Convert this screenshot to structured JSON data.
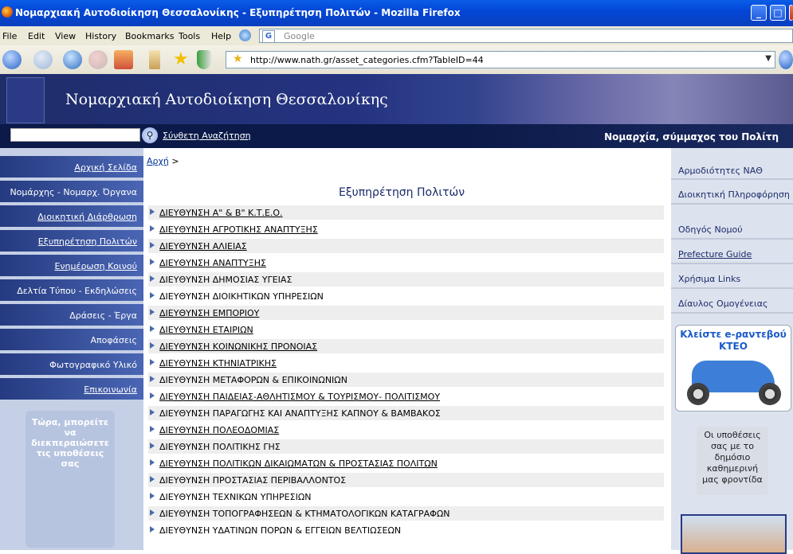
{
  "window": {
    "title": "Νομαρχιακή Αυτοδιοίκηση Θεσσαλονίκης - Εξυπηρέτηση Πολιτών - Mozilla Firefox",
    "minimize": "_",
    "maximize": "□",
    "close": "×"
  },
  "menu": [
    "File",
    "Edit",
    "View",
    "History",
    "Bookmarks",
    "Tools",
    "Help"
  ],
  "google_search": {
    "placeholder": "Google",
    "icon_label": "G"
  },
  "address": {
    "url": "http://www.nath.gr/asset_categories.cfm?TableID=44"
  },
  "banner": {
    "title": "Νομαρχιακή Αυτοδιοίκηση Θεσσαλονίκης"
  },
  "searchbar": {
    "advanced_label": "Σύνθετη Αναζήτηση",
    "tagline": "Νομαρχία, σύμμαχος του Πολίτη"
  },
  "left_nav": [
    {
      "label": "Αρχική Σελίδα",
      "underline": true
    },
    {
      "label": "Νομάρχης - Νομαρχ. Όργανα",
      "underline": false
    },
    {
      "label": "Διοικητική Διάρθρωση",
      "underline": true
    },
    {
      "label": "Εξυπηρέτηση Πολιτών",
      "underline": true
    },
    {
      "label": "Ενημέρωση Κοινού",
      "underline": true
    },
    {
      "label": "Δελτία Τύπου - Εκδηλώσεις",
      "underline": false
    },
    {
      "label": "Δράσεις - Έργα",
      "underline": false
    },
    {
      "label": "Αποφάσεις",
      "underline": false
    },
    {
      "label": "Φωτογραφικό Υλικό",
      "underline": false
    },
    {
      "label": "Επικοινωνία",
      "underline": true
    }
  ],
  "left_promo": "Τώρα, μπορείτε να διεκπεραιώσετε τις υποθέσεις σας",
  "breadcrumb": {
    "home": "Αρχή",
    "sep": ">"
  },
  "page_title": "Εξυπηρέτηση Πολιτών",
  "directorates": [
    {
      "label": "ΔΙΕΥΘΥΝΣΗ Α\" & Β\" Κ.Τ.Ε.Ο.",
      "link": true
    },
    {
      "label": "ΔΙΕΥΘΥΝΣΗ ΑΓΡΟΤΙΚΗΣ ΑΝΑΠΤΥΞΗΣ",
      "link": true
    },
    {
      "label": "ΔΙΕΥΘΥΝΣΗ ΑΛΙΕΙΑΣ",
      "link": true
    },
    {
      "label": "ΔΙΕΥΘΥΝΣΗ ΑΝΑΠΤΥΞΗΣ",
      "link": true
    },
    {
      "label": "ΔΙΕΥΘΥΝΣΗ ΔΗΜΟΣΙΑΣ ΥΓΕΙΑΣ",
      "link": false
    },
    {
      "label": "ΔΙΕΥΘΥΝΣΗ ΔΙΟΙΚΗΤΙΚΩΝ ΥΠΗΡΕΣΙΩΝ",
      "link": false
    },
    {
      "label": "ΔΙΕΥΘΥΝΣΗ ΕΜΠΟΡΙΟΥ",
      "link": true
    },
    {
      "label": "ΔΙΕΥΘΥΝΣΗ ΕΤΑΙΡΙΩΝ",
      "link": true
    },
    {
      "label": "ΔΙΕΥΘΥΝΣΗ ΚΟΙΝΩΝΙΚΗΣ ΠΡΟΝΟΙΑΣ",
      "link": true
    },
    {
      "label": "ΔΙΕΥΘΥΝΣΗ ΚΤΗΝΙΑΤΡΙΚΗΣ",
      "link": true
    },
    {
      "label": "ΔΙΕΥΘΥΝΣΗ ΜΕΤΑΦΟΡΩΝ & ΕΠΙΚΟΙΝΩΝΙΩΝ",
      "link": false
    },
    {
      "label": "ΔΙΕΥΘΥΝΣΗ ΠΑΙΔΕΙΑΣ-ΑΘΛΗΤΙΣΜΟΥ & ΤΟΥΡΙΣΜΟΥ- ΠΟΛΙΤΙΣΜΟΥ",
      "link": true
    },
    {
      "label": "ΔΙΕΥΘΥΝΣΗ ΠΑΡΑΓΩΓΗΣ ΚΑΙ ΑΝΑΠΤΥΞΗΣ ΚΑΠΝΟΥ & ΒΑΜΒΑΚΟΣ",
      "link": false
    },
    {
      "label": "ΔΙΕΥΘΥΝΣΗ ΠΟΛΕΟΔΟΜΙΑΣ",
      "link": true
    },
    {
      "label": "ΔΙΕΥΘΥΝΣΗ ΠΟΛΙΤΙΚΗΣ ΓΗΣ",
      "link": false
    },
    {
      "label": "ΔΙΕΥΘΥΝΣΗ ΠΟΛΙΤΙΚΩΝ ΔΙΚΑΙΩΜΑΤΩΝ & ΠΡΟΣΤΑΣΙΑΣ ΠΟΛΙΤΩΝ",
      "link": true
    },
    {
      "label": "ΔΙΕΥΘΥΝΣΗ ΠΡΟΣΤΑΣΙΑΣ ΠΕΡΙΒΑΛΛΟΝΤΟΣ",
      "link": false
    },
    {
      "label": "ΔΙΕΥΘΥΝΣΗ ΤΕΧΝΙΚΩΝ ΥΠΗΡΕΣΙΩΝ",
      "link": false
    },
    {
      "label": "ΔΙΕΥΘΥΝΣΗ ΤΟΠΟΓΡΑΦΗΣΕΩΝ & ΚΤΗΜΑΤΟΛΟΓΙΚΩΝ ΚΑΤΑΓΡΑΦΩΝ",
      "link": false
    },
    {
      "label": "ΔΙΕΥΘΥΝΣΗ ΥΔΑΤΙΝΩΝ ΠΟΡΩΝ & ΕΓΓΕΙΩΝ ΒΕΛΤΙΩΣΕΩΝ",
      "link": false
    }
  ],
  "right_nav": [
    {
      "label": "Αρμοδιότητες ΝΑΘ",
      "underline": false
    },
    {
      "label": "Διοικητική Πληροφόρηση",
      "underline": false
    },
    {
      "label": "Οδηγός Νομού",
      "underline": false
    },
    {
      "label": "Prefecture Guide",
      "underline": true
    },
    {
      "label": "Χρήσιμα Links",
      "underline": false
    },
    {
      "label": "Δίαυλος Ομογένειας",
      "underline": false
    }
  ],
  "ktoe_promo": "Κλείστε e-ραντεβού ΚΤΕΟ",
  "note_promo": "Οι υποθέσεις σας με το δημόσιο καθημερινή μας φροντίδα",
  "colors": {
    "banner_dark": "#1f2d6b",
    "nav_blue": "#253a80",
    "link": "#003399"
  }
}
